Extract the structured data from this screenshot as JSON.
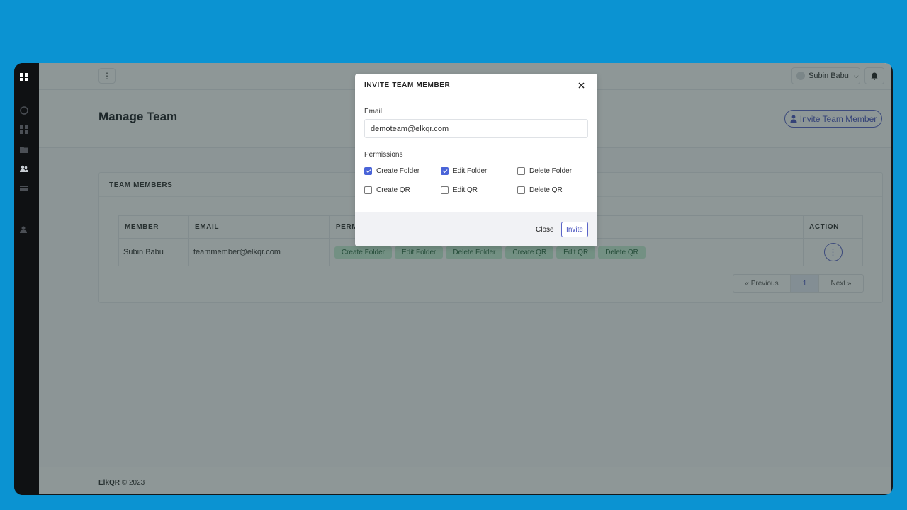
{
  "app": {
    "brand": "ElkQR",
    "footer_suffix": "© 2023"
  },
  "topbar": {
    "menu_icon": "kebab-icon",
    "user_name": "Subin Babu",
    "bell_icon": "bell-icon"
  },
  "header": {
    "title": "Manage Team",
    "invite_button": "Invite Team Member"
  },
  "card": {
    "title": "TEAM MEMBERS",
    "columns": [
      "MEMBER",
      "EMAIL",
      "PERMISSIONS",
      "ACTION"
    ],
    "rows": [
      {
        "member": "Subin Babu",
        "email": "teammember@elkqr.com",
        "permissions": [
          "Create Folder",
          "Edit Folder",
          "Delete Folder",
          "Create QR",
          "Edit QR",
          "Delete QR"
        ]
      }
    ],
    "pagination": {
      "prev": "« Previous",
      "page": "1",
      "next": "Next »"
    }
  },
  "modal": {
    "title": "INVITE TEAM MEMBER",
    "email_label": "Email",
    "email_value": "demoteam@elkqr.com",
    "permissions_label": "Permissions",
    "permissions": [
      {
        "label": "Create Folder",
        "checked": true
      },
      {
        "label": "Edit Folder",
        "checked": true
      },
      {
        "label": "Delete Folder",
        "checked": false
      },
      {
        "label": "Create QR",
        "checked": false
      },
      {
        "label": "Edit QR",
        "checked": false
      },
      {
        "label": "Delete QR",
        "checked": false
      }
    ],
    "close_label": "Close",
    "invite_label": "Invite"
  },
  "colors": {
    "background": "#0b93d2",
    "accent": "#4a54c0",
    "tag_bg": "#c8f0d6",
    "overlay": "rgba(30,48,48,0.5)"
  }
}
